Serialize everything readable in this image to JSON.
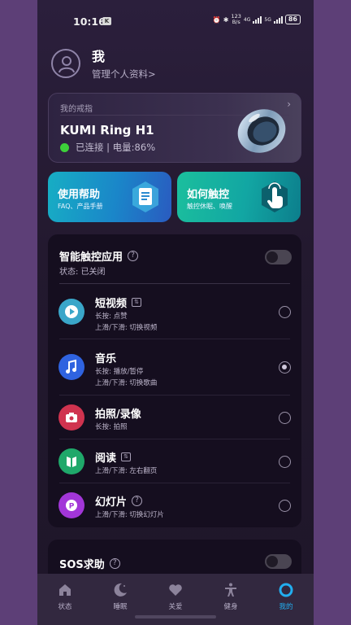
{
  "status_bar": {
    "time": "10:16",
    "app_icon_letter": "K",
    "net_speed_top": "123",
    "net_speed_unit": "B/s",
    "sig1": "4G",
    "sig2": "5G",
    "battery": "86"
  },
  "profile": {
    "name": "我",
    "manage_link": "管理个人资料>"
  },
  "ring_card": {
    "section_title": "我的戒指",
    "device_name": "KUMI Ring H1",
    "status": "已连接 | 电量:86%"
  },
  "tiles": {
    "help": {
      "title": "使用帮助",
      "subtitle": "FAQ、产品手册"
    },
    "touch": {
      "title": "如何触控",
      "subtitle": "触控休眠、唤醒"
    }
  },
  "touch_apps": {
    "title": "智能触控应用",
    "status": "状态: 已关闭",
    "toggle_on": false,
    "apps": [
      {
        "name": "短视频",
        "line1": "长按:  点赞",
        "line2": "上滑/下滑:  切换视频",
        "selected": false,
        "color": "#3aa6c9",
        "icon": "play-icon"
      },
      {
        "name": "音乐",
        "line1": "长按:  播放/暂停",
        "line2": "上滑/下滑:  切换歌曲",
        "selected": true,
        "color": "#2f63e0",
        "icon": "music-note-icon"
      },
      {
        "name": "拍照/录像",
        "line1": "长按:  拍照",
        "line2": "",
        "selected": false,
        "color": "#d0334f",
        "icon": "camera-icon"
      },
      {
        "name": "阅读",
        "line1": "上滑/下滑:  左右翻页",
        "line2": "",
        "selected": false,
        "color": "#1fa86a",
        "icon": "book-icon"
      },
      {
        "name": "幻灯片",
        "line1": "上滑/下滑:  切换幻灯片",
        "line2": "",
        "selected": false,
        "color": "#a236d8",
        "icon": "slides-icon"
      }
    ]
  },
  "sos": {
    "title": "SOS求助",
    "toggle_on": false
  },
  "bottom_nav": [
    {
      "label": "状态",
      "icon": "home-icon",
      "active": false
    },
    {
      "label": "睡眠",
      "icon": "moon-icon",
      "active": false
    },
    {
      "label": "关爱",
      "icon": "heart-icon",
      "active": false
    },
    {
      "label": "健身",
      "icon": "fitness-icon",
      "active": false
    },
    {
      "label": "我的",
      "icon": "ring-profile-icon",
      "active": true
    }
  ]
}
